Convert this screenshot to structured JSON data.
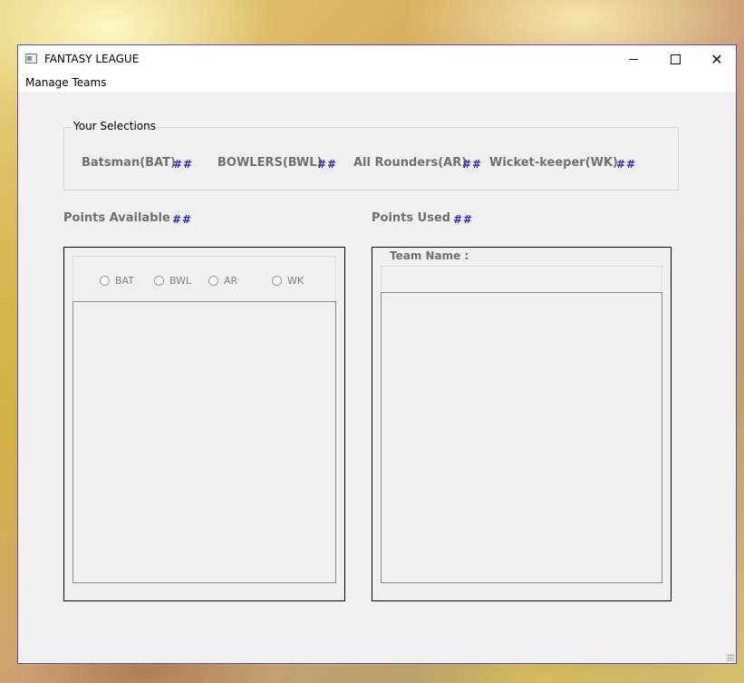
{
  "window": {
    "title": "FANTASY LEAGUE",
    "icon": "app-window-icon",
    "controls": {
      "minimize_icon": "minimize-icon",
      "maximize_icon": "maximize-icon",
      "close_glyph": "✕"
    }
  },
  "menu": {
    "items": [
      {
        "label": "Manage Teams"
      }
    ]
  },
  "selections": {
    "legend": "Your Selections",
    "items": [
      {
        "label": "Batsman(BAT)",
        "value": "##"
      },
      {
        "label": "BOWLERS(BWL)",
        "value": "##"
      },
      {
        "label": "All Rounders(AR)",
        "value": "##"
      },
      {
        "label": "Wicket-keeper(WK)",
        "value": "##"
      }
    ]
  },
  "points": {
    "available_label": "Points Available",
    "available_value": "##",
    "used_label": "Points Used",
    "used_value": "##"
  },
  "player_filter": {
    "options": [
      {
        "label": "BAT",
        "selected": false
      },
      {
        "label": "BWL",
        "selected": false
      },
      {
        "label": "AR",
        "selected": false
      },
      {
        "label": "WK",
        "selected": false
      }
    ]
  },
  "team": {
    "name_label": "Team Name :",
    "name_value": ""
  },
  "colors": {
    "accent_value": "#2d2db3",
    "label_gray": "#707070",
    "window_border": "#5b4bbf"
  }
}
